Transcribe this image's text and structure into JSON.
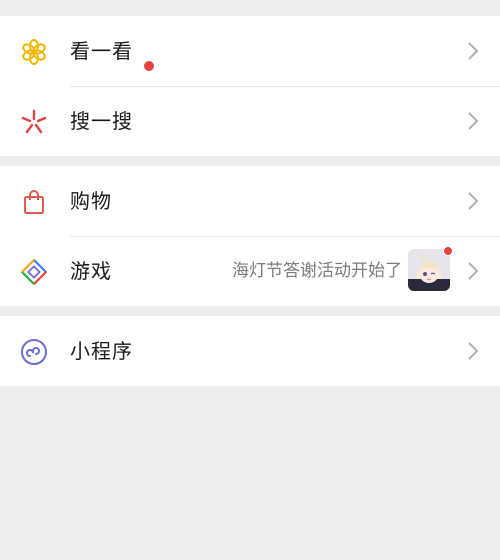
{
  "colors": {
    "background": "#ededed",
    "row_background": "#ffffff",
    "badge_red": "#e64340",
    "moments_yellow": "#f2b705",
    "search_red": "#e64340",
    "shop_red": "#e05a4e",
    "program_purple": "#6b6bd6",
    "chevron_gray": "#b2b2b2",
    "subtitle_gray": "#7b7b7b"
  },
  "groups": [
    {
      "rows": [
        {
          "label": "看一看",
          "icon": "moments-flower-icon",
          "badge": true
        },
        {
          "label": "搜一搜",
          "icon": "search-spark-icon"
        }
      ]
    },
    {
      "rows": [
        {
          "label": "购物",
          "icon": "shopping-bag-icon"
        },
        {
          "label": "游戏",
          "icon": "game-diamond-icon",
          "subtitle": "海灯节答谢活动开始了",
          "thumbnail": "anime-avatar-thumbnail",
          "thumbnail_badge": true
        }
      ]
    },
    {
      "rows": [
        {
          "label": "小程序",
          "icon": "mini-program-icon"
        }
      ]
    }
  ]
}
